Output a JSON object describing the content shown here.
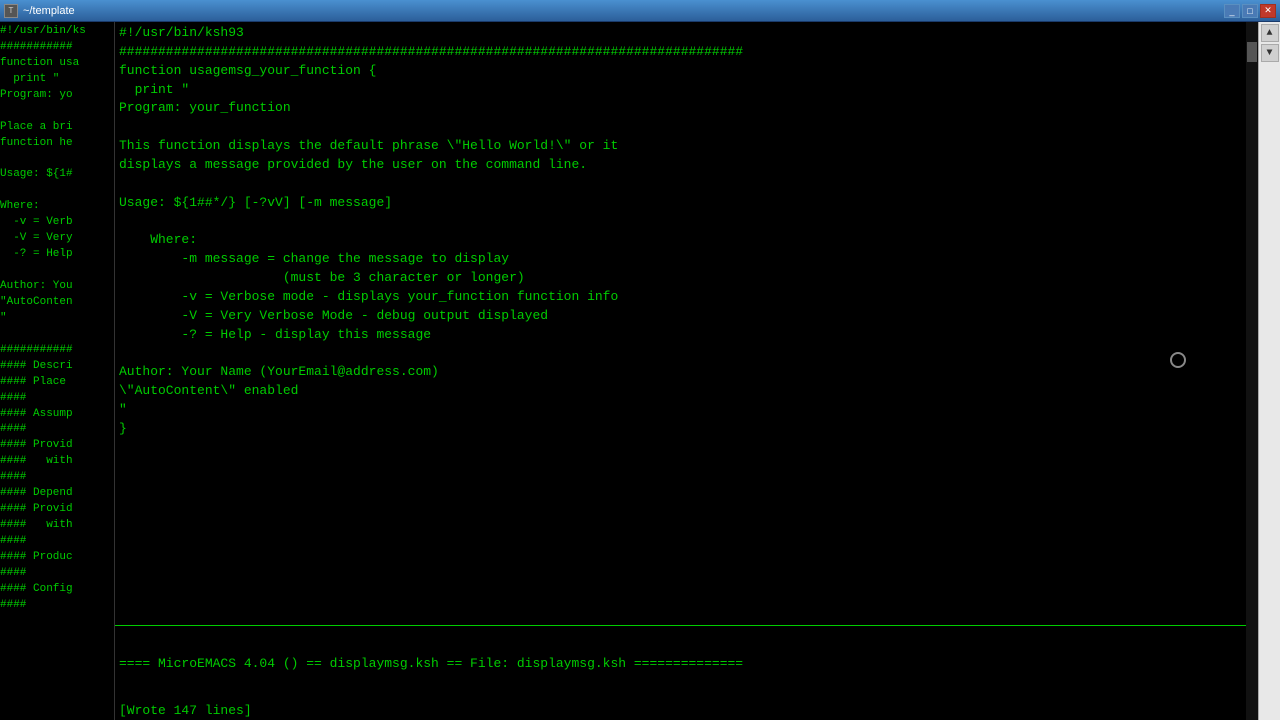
{
  "window": {
    "title": "~/template",
    "icon_label": "T"
  },
  "window_controls": {
    "minimize": "_",
    "maximize": "□",
    "close": "✕"
  },
  "left_panel": {
    "content": "#!/usr/bin/ks\n###########\nfunction usa\n  print \"\nProgram: yo\n\nPlace a bri\nfunction he\n\nUsage: ${1#\n\nWhere:\n  -v = Ver\n  -V = Ver\n  -? = Hel\n\nAuthor: You\n\"AutoConten\n\"\n\n###########\n#### Descri\n#### Place \n####\n#### Assump\n####\n#### Provid\n####   with\n####\n#### Depend\n#### Provid\n####   with\n####\n#### Produc\n####\n#### Config\n####"
  },
  "editor": {
    "content": "#!/usr/bin/ksh93\n################################################################################\nfunction usagemsg_your_function {\n  print \"\nProgram: your_function\n\nThis function displays the default phrase \\\"Hello World!\\\" or it\ndisplays a message provided by the user on the command line.\n\nUsage: ${1##*/} [-?vV] [-m message]\n\n    Where:\n        -m message = change the message to display\n                     (must be 3 character or longer)\n        -v = Verbose mode - displays your_function function info\n        -V = Very Verbose Mode - debug output displayed\n        -? = Help - display this message\n\nAuthor: Your Name (YourEmail@address.com)\n\\\"AutoContent\\\" enabled\n\"\n}"
  },
  "status": {
    "bar": "==== MicroEMACS 4.04 () == displaymsg.ksh == File: displaymsg.ksh ==============",
    "message": "[Wrote 147 lines]"
  },
  "browser_nav": {
    "up_arrow": "▲",
    "down_arrow": "▼"
  }
}
